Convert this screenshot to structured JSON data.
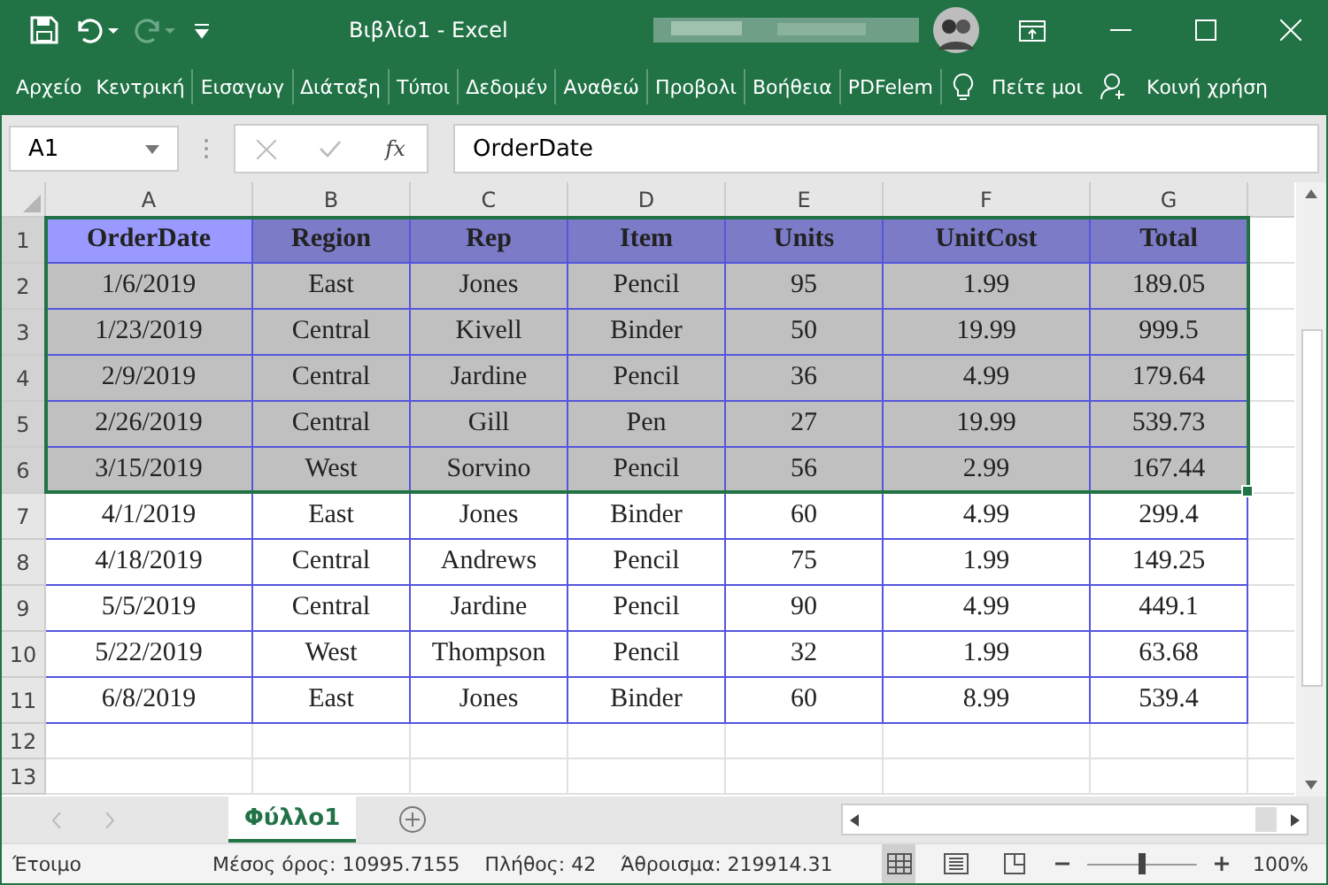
{
  "window": {
    "title": "Βιβλίο1  -  Excel"
  },
  "ribbon_tabs": [
    {
      "label": "Αρχείο",
      "selected": false
    },
    {
      "label": "Κεντρική",
      "selected": false
    },
    {
      "label": "Εισαγωγ",
      "selected": false
    },
    {
      "label": "Διάταξη",
      "selected": false
    },
    {
      "label": "Τύποι",
      "selected": false
    },
    {
      "label": "Δεδομέν",
      "selected": false
    },
    {
      "label": "Αναθεώ",
      "selected": false
    },
    {
      "label": "Προβολι",
      "selected": false
    },
    {
      "label": "Βοήθεια",
      "selected": false
    },
    {
      "label": "PDFelem",
      "selected": false
    }
  ],
  "tell_me": "Πείτε μοι",
  "share": "Κοινή χρήση",
  "formula_bar": {
    "name_box": "A1",
    "fx": "fx",
    "value": "OrderDate"
  },
  "columns": [
    "A",
    "B",
    "C",
    "D",
    "E",
    "F",
    "G"
  ],
  "rows": [
    {
      "number": "1",
      "kind": "header",
      "selected": true,
      "cells": [
        "OrderDate",
        "Region",
        "Rep",
        "Item",
        "Units",
        "UnitCost",
        "Total"
      ]
    },
    {
      "number": "2",
      "kind": "data",
      "selected": true,
      "cells": [
        "1/6/2019",
        "East",
        "Jones",
        "Pencil",
        "95",
        "1.99",
        "189.05"
      ]
    },
    {
      "number": "3",
      "kind": "data",
      "selected": true,
      "cells": [
        "1/23/2019",
        "Central",
        "Kivell",
        "Binder",
        "50",
        "19.99",
        "999.5"
      ]
    },
    {
      "number": "4",
      "kind": "data",
      "selected": true,
      "cells": [
        "2/9/2019",
        "Central",
        "Jardine",
        "Pencil",
        "36",
        "4.99",
        "179.64"
      ]
    },
    {
      "number": "5",
      "kind": "data",
      "selected": true,
      "cells": [
        "2/26/2019",
        "Central",
        "Gill",
        "Pen",
        "27",
        "19.99",
        "539.73"
      ]
    },
    {
      "number": "6",
      "kind": "data",
      "selected": true,
      "cells": [
        "3/15/2019",
        "West",
        "Sorvino",
        "Pencil",
        "56",
        "2.99",
        "167.44"
      ]
    },
    {
      "number": "7",
      "kind": "data",
      "selected": false,
      "cells": [
        "4/1/2019",
        "East",
        "Jones",
        "Binder",
        "60",
        "4.99",
        "299.4"
      ]
    },
    {
      "number": "8",
      "kind": "data",
      "selected": false,
      "cells": [
        "4/18/2019",
        "Central",
        "Andrews",
        "Pencil",
        "75",
        "1.99",
        "149.25"
      ]
    },
    {
      "number": "9",
      "kind": "data",
      "selected": false,
      "cells": [
        "5/5/2019",
        "Central",
        "Jardine",
        "Pencil",
        "90",
        "4.99",
        "449.1"
      ]
    },
    {
      "number": "10",
      "kind": "data",
      "selected": false,
      "cells": [
        "5/22/2019",
        "West",
        "Thompson",
        "Pencil",
        "32",
        "1.99",
        "63.68"
      ]
    },
    {
      "number": "11",
      "kind": "data",
      "selected": false,
      "cells": [
        "6/8/2019",
        "East",
        "Jones",
        "Binder",
        "60",
        "8.99",
        "539.4"
      ]
    },
    {
      "number": "12",
      "kind": "empty",
      "selected": false,
      "cells": []
    },
    {
      "number": "13",
      "kind": "empty",
      "selected": false,
      "cells": []
    }
  ],
  "sheet_tabs": [
    {
      "label": "Φύλλο1",
      "selected": true
    }
  ],
  "status_bar": {
    "state": "Έτοιμο",
    "average": "Μέσος όρος: 10995.7155",
    "count": "Πλήθος: 42",
    "sum": "Άθροισμα: 219914.31",
    "zoom": {
      "level": 0.5,
      "reading": "100%"
    }
  }
}
